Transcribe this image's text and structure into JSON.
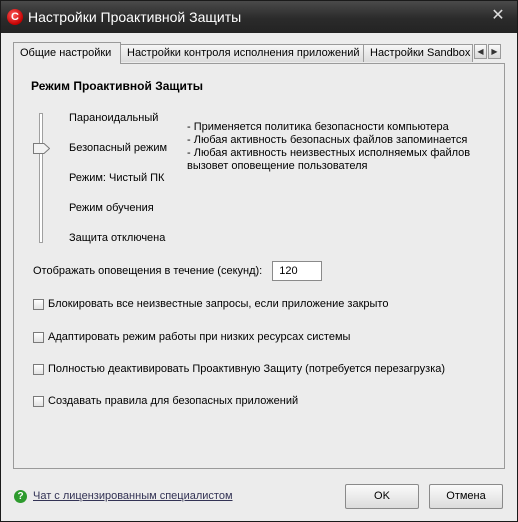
{
  "window": {
    "title": "Настройки Проактивной Защиты",
    "app_icon_letter": "C"
  },
  "tabs": [
    {
      "label": "Общие настройки",
      "active": true
    },
    {
      "label": "Настройки контроля исполнения приложений",
      "active": false
    },
    {
      "label": "Настройки Sandbox",
      "active": false
    }
  ],
  "section": {
    "title": "Режим Проактивной Защиты"
  },
  "levels": [
    {
      "label": "Параноидальный"
    },
    {
      "label": "Безопасный режим"
    },
    {
      "label": "Режим: Чистый ПК"
    },
    {
      "label": "Режим обучения"
    },
    {
      "label": "Защита отключена"
    }
  ],
  "selected_level": "Безопасный режим",
  "description": [
    "- Применяется политика безопасности компьютера",
    "- Любая активность безопасных файлов запоминается",
    "- Любая активность неизвестных исполняемых файлов",
    "вызовет оповещение пользователя"
  ],
  "alert_duration": {
    "label": "Отображать оповещения в течение (секунд):",
    "value": "120"
  },
  "checkboxes": [
    {
      "label": "Блокировать все неизвестные запросы, если приложение закрыто",
      "checked": false
    },
    {
      "label": "Адаптировать режим работы при низких ресурсах системы",
      "checked": false
    },
    {
      "label": "Полностью деактивировать Проактивную Защиту (потребуется перезагрузка)",
      "checked": false
    },
    {
      "label": "Создавать правила для безопасных приложений",
      "checked": false
    }
  ],
  "footer": {
    "help_icon": "help-icon",
    "help_link": "Чат с лицензированным специалистом",
    "ok_label": "OK",
    "cancel_label": "Отмена"
  },
  "colors": {
    "titlebar": "#2b2b2b",
    "app_icon": "#c40000",
    "help_icon": "#2e9b2e"
  }
}
